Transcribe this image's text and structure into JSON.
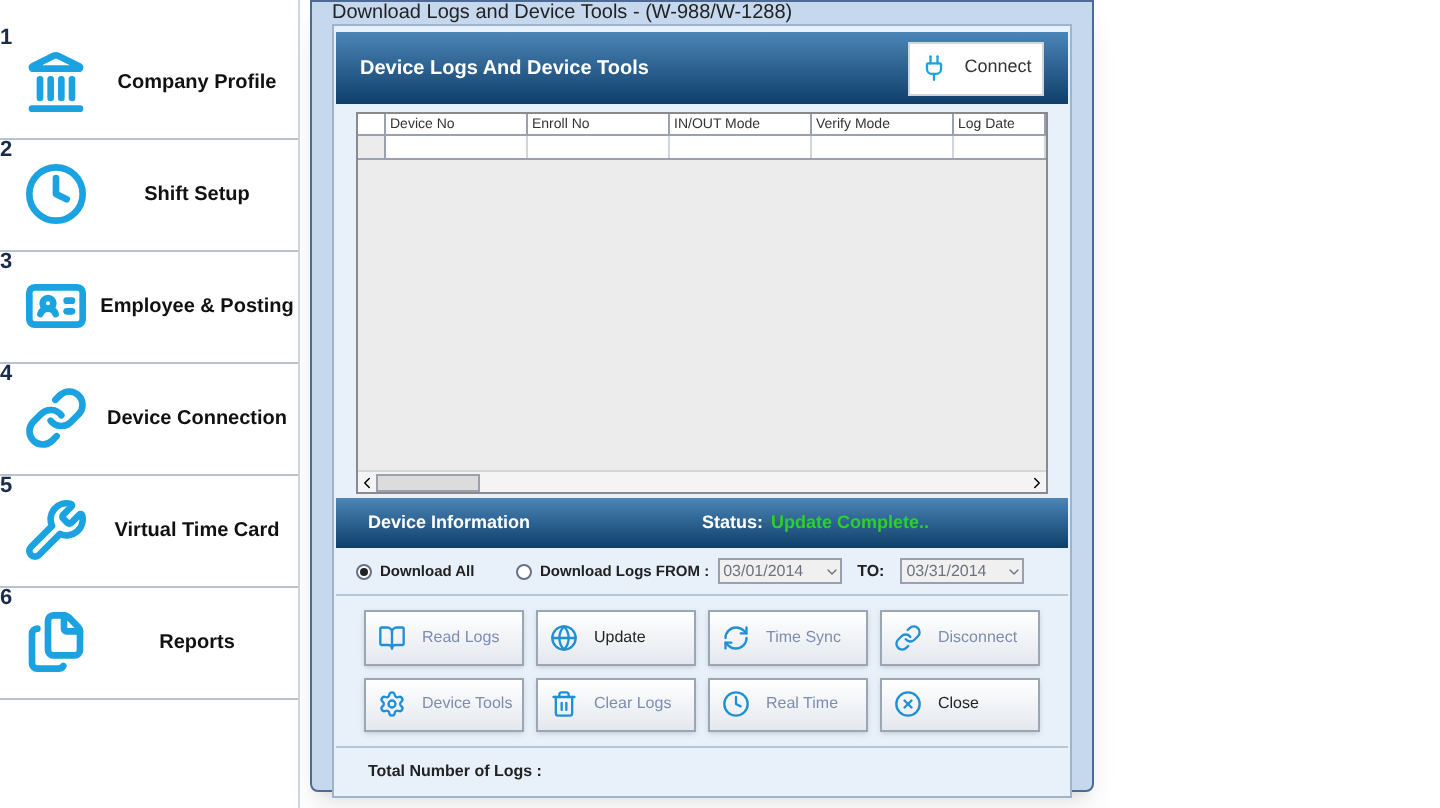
{
  "sidebar": {
    "items": [
      {
        "number": "1",
        "label": "Company Profile"
      },
      {
        "number": "2",
        "label": "Shift Setup"
      },
      {
        "number": "3",
        "label": "Employee & Posting"
      },
      {
        "number": "4",
        "label": "Device Connection"
      },
      {
        "number": "5",
        "label": "Virtual Time Card"
      },
      {
        "number": "6",
        "label": "Reports"
      }
    ]
  },
  "window": {
    "title": "Download Logs and Device Tools - (W-988/W-1288)"
  },
  "header": {
    "title": "Device Logs And Device Tools",
    "connect_button": "Connect"
  },
  "table": {
    "columns": [
      "Device No",
      "Enroll No",
      "IN/OUT Mode",
      "Verify Mode",
      "Log Date"
    ]
  },
  "info_bar": {
    "title": "Device Information",
    "status_label": "Status:",
    "status_value": "Update Complete.."
  },
  "options": [
    {
      "label": "Download All",
      "selected": true
    },
    {
      "label": "Download Logs FROM :",
      "selected": false
    }
  ],
  "date_from": "03/01/2014",
  "date_to_label": "TO:",
  "date_to": "03/31/2014",
  "buttons": [
    {
      "label": "Read Logs",
      "disabled": true
    },
    {
      "label": "Update",
      "disabled": false
    },
    {
      "label": "Time Sync",
      "disabled": true
    },
    {
      "label": "Disconnect",
      "disabled": true
    },
    {
      "label": "Device Tools",
      "disabled": true
    },
    {
      "label": "Clear Logs",
      "disabled": true
    },
    {
      "label": "Real Time",
      "disabled": true
    },
    {
      "label": "Close",
      "disabled": false
    }
  ],
  "footer": {
    "label": "Total Number of Logs :"
  }
}
